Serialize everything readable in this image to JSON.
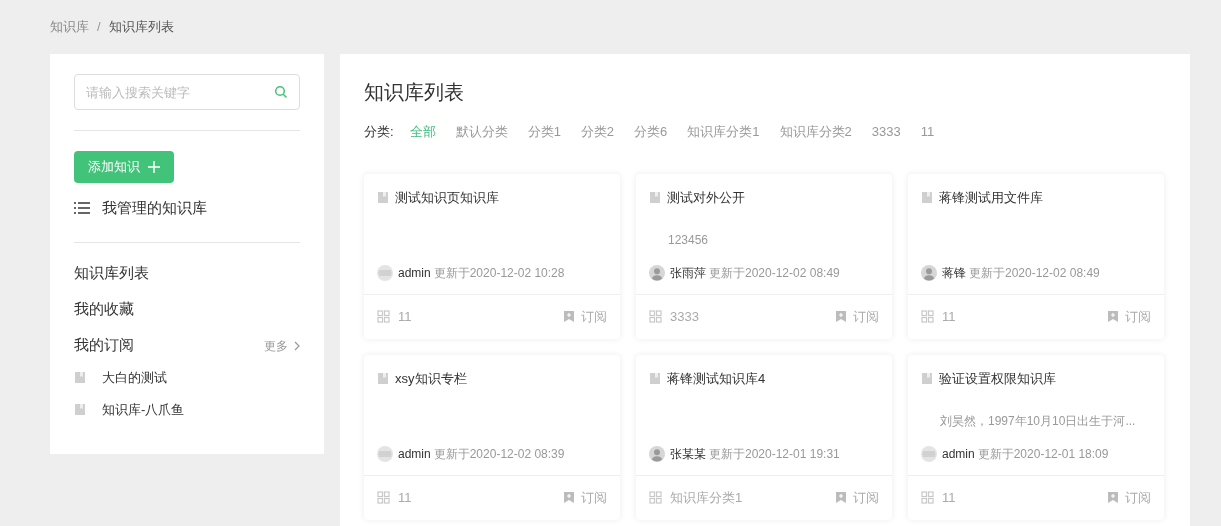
{
  "breadcrumb": [
    "知识库",
    "知识库列表"
  ],
  "breadcrumb_separator": "/",
  "sidebar": {
    "search": {
      "placeholder": "请输入搜索关键字"
    },
    "add_button": "添加知识",
    "managed_link": "我管理的知识库",
    "nav": [
      {
        "label": "知识库列表"
      },
      {
        "label": "我的收藏"
      },
      {
        "label": "我的订阅",
        "more": "更多"
      }
    ],
    "subscriptions": [
      "大白的测试",
      "知识库-八爪鱼"
    ]
  },
  "main": {
    "title": "知识库列表",
    "filter_label": "分类:",
    "categories": [
      {
        "label": "全部",
        "selected": true
      },
      {
        "label": "默认分类",
        "selected": false
      },
      {
        "label": "分类1",
        "selected": false
      },
      {
        "label": "分类2",
        "selected": false
      },
      {
        "label": "分类6",
        "selected": false
      },
      {
        "label": "知识库分类1",
        "selected": false
      },
      {
        "label": "知识库分类2",
        "selected": false
      },
      {
        "label": "3333",
        "selected": false
      },
      {
        "label": "11",
        "selected": false
      }
    ],
    "cards": [
      {
        "title": "测试知识页知识库",
        "avatar": {
          "kind": "pattern"
        },
        "author": "admin",
        "updated": "更新于2020-12-02 10:28",
        "category": "11",
        "subscribe": "订阅"
      },
      {
        "title": "测试对外公开",
        "description": "123456",
        "avatar": {
          "kind": "person"
        },
        "author": "张雨萍",
        "updated": "更新于2020-12-02 08:49",
        "category": "3333",
        "subscribe": "订阅"
      },
      {
        "title": "蒋锋测试用文件库",
        "avatar": {
          "kind": "person"
        },
        "author": "蒋锋",
        "updated": "更新于2020-12-02 08:49",
        "category": "11",
        "subscribe": "订阅"
      },
      {
        "title": "xsy知识专栏",
        "avatar": {
          "kind": "pattern"
        },
        "author": "admin",
        "updated": "更新于2020-12-02 08:39",
        "category": "11",
        "subscribe": "订阅"
      },
      {
        "title": "蒋锋测试知识库4",
        "avatar": {
          "kind": "person"
        },
        "author": "张某某",
        "updated": "更新于2020-12-01 19:31",
        "category": "知识库分类1",
        "subscribe": "订阅"
      },
      {
        "title": "验证设置权限知识库",
        "description": "刘昊然，1997年10月10日出生于河...",
        "avatar": {
          "kind": "pattern"
        },
        "author": "admin",
        "updated": "更新于2020-12-01 18:09",
        "category": "11",
        "subscribe": "订阅"
      }
    ]
  }
}
